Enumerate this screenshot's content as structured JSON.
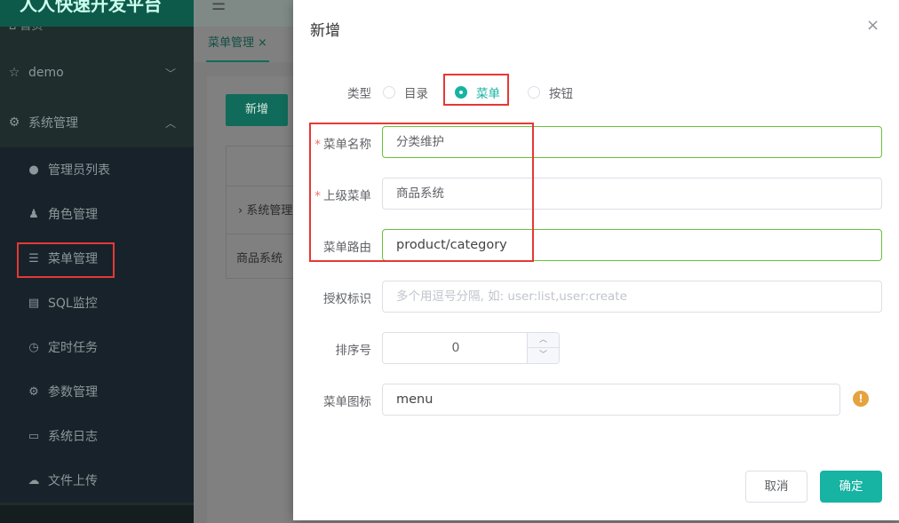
{
  "sidebar": {
    "brand": "人人快速开发平台",
    "brand_sub": "首页",
    "groups": [
      {
        "label": "demo",
        "icon": "star-icon"
      },
      {
        "label": "系统管理",
        "icon": "gear-icon"
      }
    ],
    "items": [
      {
        "label": "管理员列表",
        "icon": "user-icon"
      },
      {
        "label": "角色管理",
        "icon": "role-icon"
      },
      {
        "label": "菜单管理",
        "icon": "list-icon"
      },
      {
        "label": "SQL监控",
        "icon": "monitor-icon"
      },
      {
        "label": "定时任务",
        "icon": "clock-icon"
      },
      {
        "label": "参数管理",
        "icon": "params-icon"
      },
      {
        "label": "系统日志",
        "icon": "log-icon"
      },
      {
        "label": "文件上传",
        "icon": "upload-icon"
      }
    ]
  },
  "topbar": {
    "menu_glyph": "☰"
  },
  "tabs": [
    {
      "label": "菜单管理",
      "close": "×"
    }
  ],
  "content": {
    "add_button": "新增",
    "row1": "系统管理",
    "row2": "商品系统"
  },
  "modal": {
    "title": "新增",
    "close": "×",
    "type_label": "类型",
    "type_options": [
      "目录",
      "菜单",
      "按钮"
    ],
    "type_selected": "菜单",
    "name_label": "菜单名称",
    "name_value": "分类维护",
    "parent_label": "上级菜单",
    "parent_value": "商品系统",
    "route_label": "菜单路由",
    "route_value": "product/category",
    "perm_label": "授权标识",
    "perm_placeholder": "多个用逗号分隔, 如: user:list,user:create",
    "order_label": "排序号",
    "order_value": "0",
    "icon_label": "菜单图标",
    "icon_value": "menu",
    "cancel": "取消",
    "confirm": "确定"
  },
  "colors": {
    "accent": "#17b3a3",
    "sidebar_bg": "#1f2d2d",
    "highlight": "#e53935",
    "warning": "#e6a23c",
    "valid": "#67c23a"
  }
}
